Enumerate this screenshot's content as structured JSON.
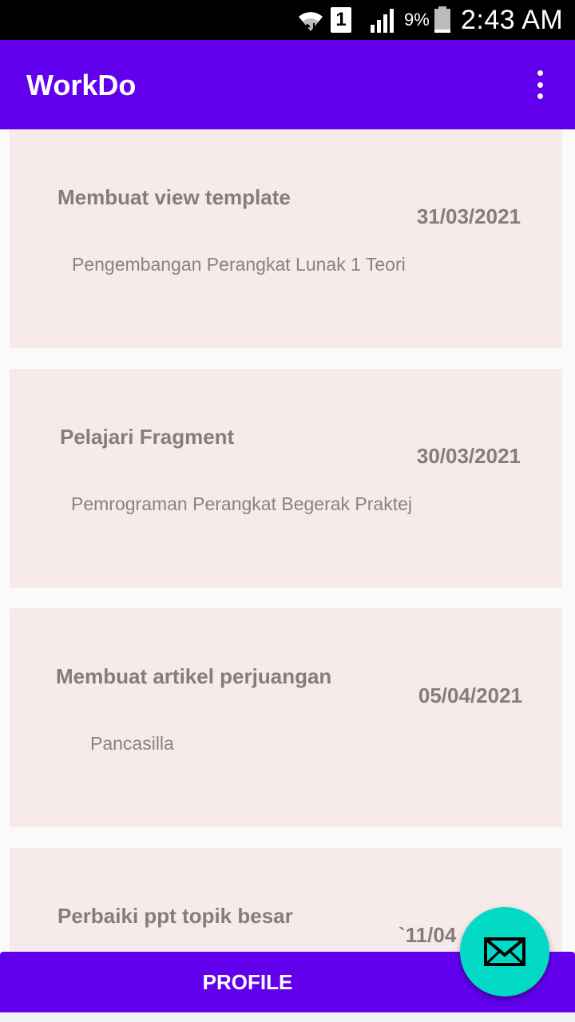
{
  "status_bar": {
    "battery_percent": "9%",
    "time": "2:43 AM",
    "sim_label": "1",
    "icons": [
      "wifi-icon",
      "sim-icon",
      "signal-icon",
      "battery-icon"
    ]
  },
  "app_bar": {
    "title": "WorkDo",
    "menu_icon": "overflow-menu-icon"
  },
  "tasks": [
    {
      "title": "Membuat view template",
      "date": "31/03/2021",
      "subject": "Pengembangan Perangkat Lunak 1 Teori"
    },
    {
      "title": "Pelajari Fragment",
      "date": "30/03/2021",
      "subject": "Pemrograman Perangkat Begerak Praktej"
    },
    {
      "title": "Membuat artikel perjuangan",
      "date": "05/04/2021",
      "subject": "Pancasilla"
    },
    {
      "title": "Perbaiki ppt topik besar",
      "date": "`11/04",
      "subject": ""
    }
  ],
  "bottom_button": {
    "label": "PROFILE"
  },
  "fab": {
    "icon": "mail-icon"
  },
  "colors": {
    "primary": "#6200ee",
    "accent": "#03dac5",
    "card_background": "#f7eaea",
    "text_muted": "#857c7c"
  }
}
